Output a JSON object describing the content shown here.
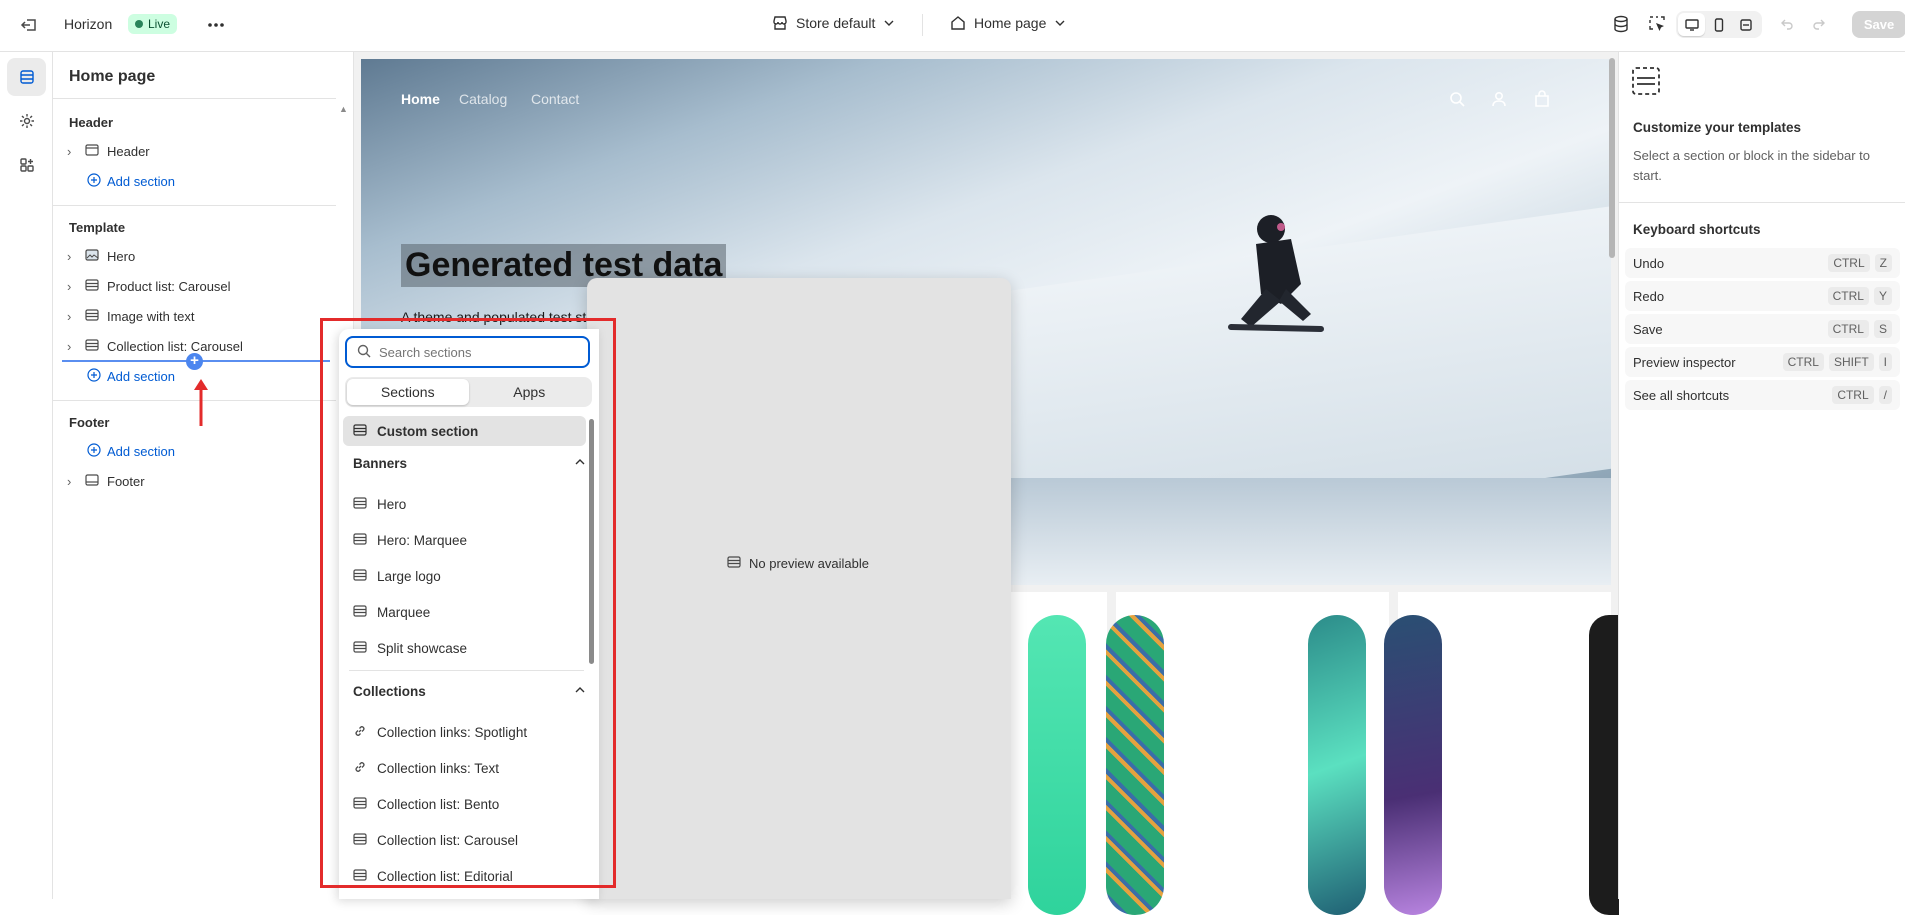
{
  "topbar": {
    "store_name": "Horizon",
    "status_badge": "Live",
    "theme_selector": "Store default",
    "page_selector": "Home page",
    "save_label": "Save"
  },
  "sidebar": {
    "title": "Home page",
    "header_group": {
      "label": "Header",
      "items": [
        "Header"
      ],
      "add_label": "Add section"
    },
    "template_group": {
      "label": "Template",
      "items": [
        "Hero",
        "Product list: Carousel",
        "Image with text",
        "Collection list: Carousel"
      ],
      "add_label": "Add section"
    },
    "footer_group": {
      "label": "Footer",
      "items": [
        "Footer"
      ],
      "add_label": "Add section"
    }
  },
  "preview": {
    "nav": [
      "Home",
      "Catalog",
      "Contact"
    ],
    "headline": "Generated test data",
    "subline": "A theme and populated test store by Shopify"
  },
  "picker": {
    "search_placeholder": "Search sections",
    "tabs": [
      "Sections",
      "Apps"
    ],
    "custom_item": "Custom section",
    "banners": {
      "label": "Banners",
      "items": [
        "Hero",
        "Hero: Marquee",
        "Large logo",
        "Marquee",
        "Split showcase"
      ]
    },
    "collections": {
      "label": "Collections",
      "items": [
        "Collection links: Spotlight",
        "Collection links: Text",
        "Collection list: Bento",
        "Collection list: Carousel",
        "Collection list: Editorial"
      ]
    },
    "no_preview": "No preview available"
  },
  "right_panel": {
    "title": "Customize your templates",
    "description": "Select a section or block in the sidebar to start.",
    "shortcuts_title": "Keyboard shortcuts",
    "shortcuts": [
      {
        "label": "Undo",
        "keys": [
          "CTRL",
          "Z"
        ]
      },
      {
        "label": "Redo",
        "keys": [
          "CTRL",
          "Y"
        ]
      },
      {
        "label": "Save",
        "keys": [
          "CTRL",
          "S"
        ]
      },
      {
        "label": "Preview inspector",
        "keys": [
          "CTRL",
          "SHIFT",
          "I"
        ]
      },
      {
        "label": "See all shortcuts",
        "keys": [
          "CTRL",
          "/"
        ]
      }
    ]
  },
  "colors": {
    "accent": "#005bd3",
    "live_bg": "#cdfee1",
    "annotation_red": "#e32b2b",
    "insert_blue": "#4c86ef"
  },
  "icons": [
    "exit-icon",
    "more-icon",
    "store-icon",
    "home-icon",
    "chevron-down-icon",
    "database-icon",
    "inspector-icon",
    "desktop-icon",
    "mobile-icon",
    "fullwidth-icon",
    "undo-icon",
    "redo-icon",
    "sections-icon",
    "gear-icon",
    "apps-icon",
    "search-icon",
    "account-icon",
    "cart-icon",
    "link-icon"
  ]
}
